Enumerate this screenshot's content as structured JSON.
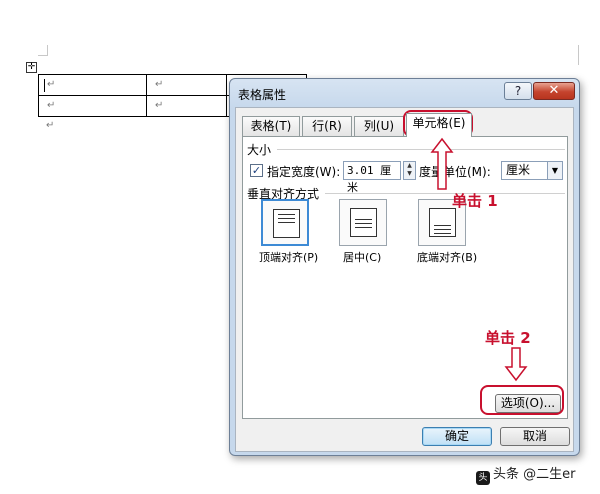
{
  "document": {
    "move_handle_glyph": "✛",
    "paragraph_mark": "↵",
    "rows": [
      [
        "↵",
        "↵",
        "",
        ""
      ],
      [
        "↵",
        "↵",
        "",
        ""
      ]
    ],
    "after_table_mark": "↵"
  },
  "dialog": {
    "title": "表格属性",
    "help_glyph": "?",
    "close_glyph": "✕",
    "tabs": [
      {
        "label": "表格(T)",
        "active": false
      },
      {
        "label": "行(R)",
        "active": false
      },
      {
        "label": "列(U)",
        "active": false
      },
      {
        "label": "单元格(E)",
        "active": true
      }
    ],
    "size_section": {
      "heading": "大小",
      "specify_width_checked": true,
      "specify_width_label": "指定宽度(W):",
      "width_value": "3.01 厘米",
      "measure_label": "度量单位(M):",
      "measure_value": "厘米"
    },
    "valign_section": {
      "heading": "垂直对齐方式",
      "options": [
        {
          "label": "顶端对齐(P)",
          "selected": true
        },
        {
          "label": "居中(C)",
          "selected": false
        },
        {
          "label": "底端对齐(B)",
          "selected": false
        }
      ]
    },
    "options_button": "选项(O)...",
    "ok_button": "确定",
    "cancel_button": "取消"
  },
  "annotations": {
    "step1": "单击 1",
    "step2": "单击 2",
    "color": "#c8102e"
  },
  "watermark": {
    "text": "头条 @二生er"
  }
}
